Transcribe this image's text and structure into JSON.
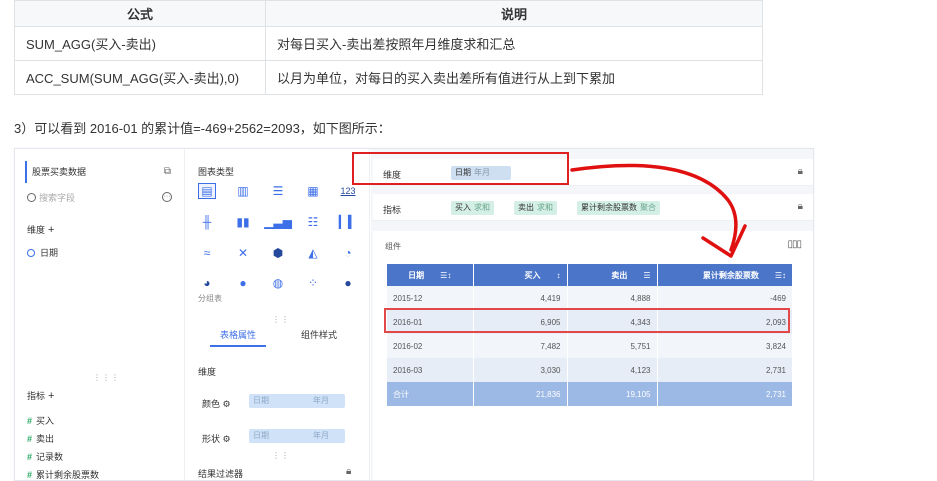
{
  "formula_table": {
    "headers": [
      "公式",
      "说明"
    ],
    "rows": [
      [
        "SUM_AGG(买入-卖出)",
        "对每日买入-卖出差按照年月维度求和汇总"
      ],
      [
        "ACC_SUM(SUM_AGG(买入-卖出),0)",
        "以月为单位，对每日的买入卖出差所有值进行从上到下累加"
      ]
    ]
  },
  "caption": "3）可以看到 2016-01 的累计值=-469+2562=2093，如下图所示：",
  "data_panel": {
    "dataset": "股票买卖数据",
    "search_placeholder": "搜索字段",
    "dimension_label": "维度",
    "dimension_fields": [
      "日期"
    ],
    "measure_label": "指标",
    "measure_fields": [
      "买入",
      "卖出",
      "记录数",
      "累计剩余股票数"
    ],
    "plus": "+"
  },
  "chart_panel": {
    "title": "图表类型",
    "group_label": "分组表",
    "icon_text": "123",
    "tabs": [
      "表格属性",
      "组件样式"
    ],
    "dimension_label": "维度",
    "color_label": "颜色",
    "shape_label": "形状",
    "pill_left": "日期",
    "pill_right": "年月",
    "filter_label": "结果过滤器"
  },
  "main_panel": {
    "dim_label": "维度",
    "dim_chip": {
      "name": "日期",
      "sub": "年月"
    },
    "measure_label": "指标",
    "measure_chips": [
      {
        "name": "买入",
        "sub": "求和"
      },
      {
        "name": "卖出",
        "sub": "求和"
      },
      {
        "name": "累计剩余股票数",
        "sub": "聚合"
      }
    ],
    "widget_title": "组件",
    "table": {
      "headers": [
        "日期",
        "买入",
        "卖出",
        "累计剩余股票数"
      ],
      "rows": [
        [
          "2015-12",
          "4,419",
          "4,888",
          "-469"
        ],
        [
          "2016-01",
          "6,905",
          "4,343",
          "2,093"
        ],
        [
          "2016-02",
          "7,482",
          "5,751",
          "3,824"
        ],
        [
          "2016-03",
          "3,030",
          "4,123",
          "2,731"
        ]
      ],
      "total": [
        "合计",
        "21,836",
        "19,105",
        "2,731"
      ]
    }
  },
  "colors": {
    "accent": "#3d6fe8",
    "table_header": "#4b75c9",
    "highlight_red": "#e02020"
  }
}
